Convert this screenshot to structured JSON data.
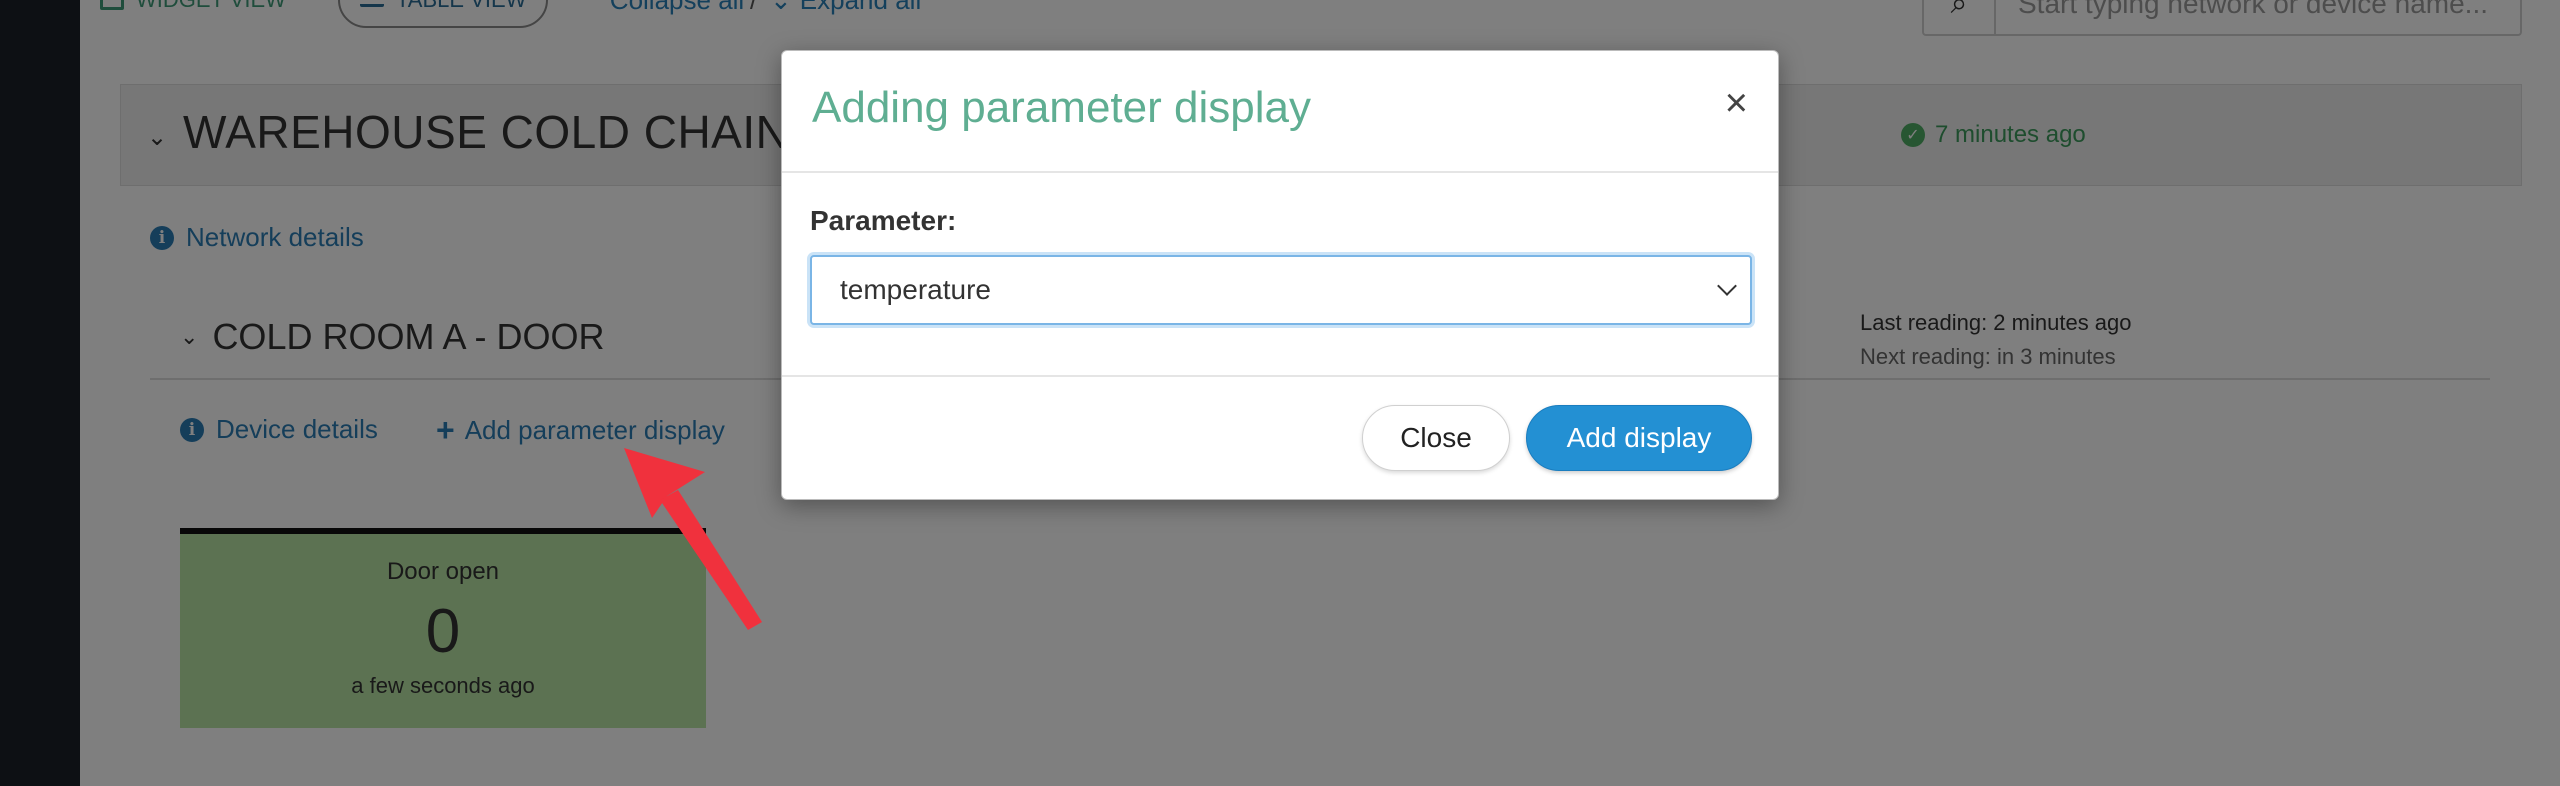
{
  "toolbar": {
    "widget_view": "WIDGET VIEW",
    "table_view": "TABLE VIEW",
    "collapse_all": "Collapse all",
    "separator": "/",
    "expand_all": "Expand all",
    "search_placeholder": "Start typing network or device name..."
  },
  "network": {
    "title": "WAREHOUSE COLD CHAIN",
    "status": "7 minutes ago",
    "details_link": "Network details"
  },
  "device": {
    "title": "COLD ROOM A - DOOR",
    "last_reading": "Last reading: 2 minutes ago",
    "next_reading": "Next reading: in 3 minutes",
    "details_link": "Device details",
    "add_param_link": "Add parameter display"
  },
  "widget": {
    "label": "Door open",
    "value": "0",
    "time": "a few seconds ago",
    "color": "#b8e4a4"
  },
  "modal": {
    "title": "Adding parameter display",
    "close_glyph": "×",
    "field_label": "Parameter:",
    "selected": "temperature",
    "close_button": "Close",
    "add_button": "Add display"
  },
  "colors": {
    "accent_blue": "#2390d3",
    "title_green": "#5fae92",
    "arrow_red": "#f0313d"
  },
  "icons": [
    "grid-icon",
    "list-icon",
    "collapse-icon",
    "expand-icon",
    "search-icon",
    "chevron-down-icon",
    "check-circle-icon",
    "info-icon",
    "plus-icon",
    "close-icon",
    "arrow-annotation"
  ]
}
